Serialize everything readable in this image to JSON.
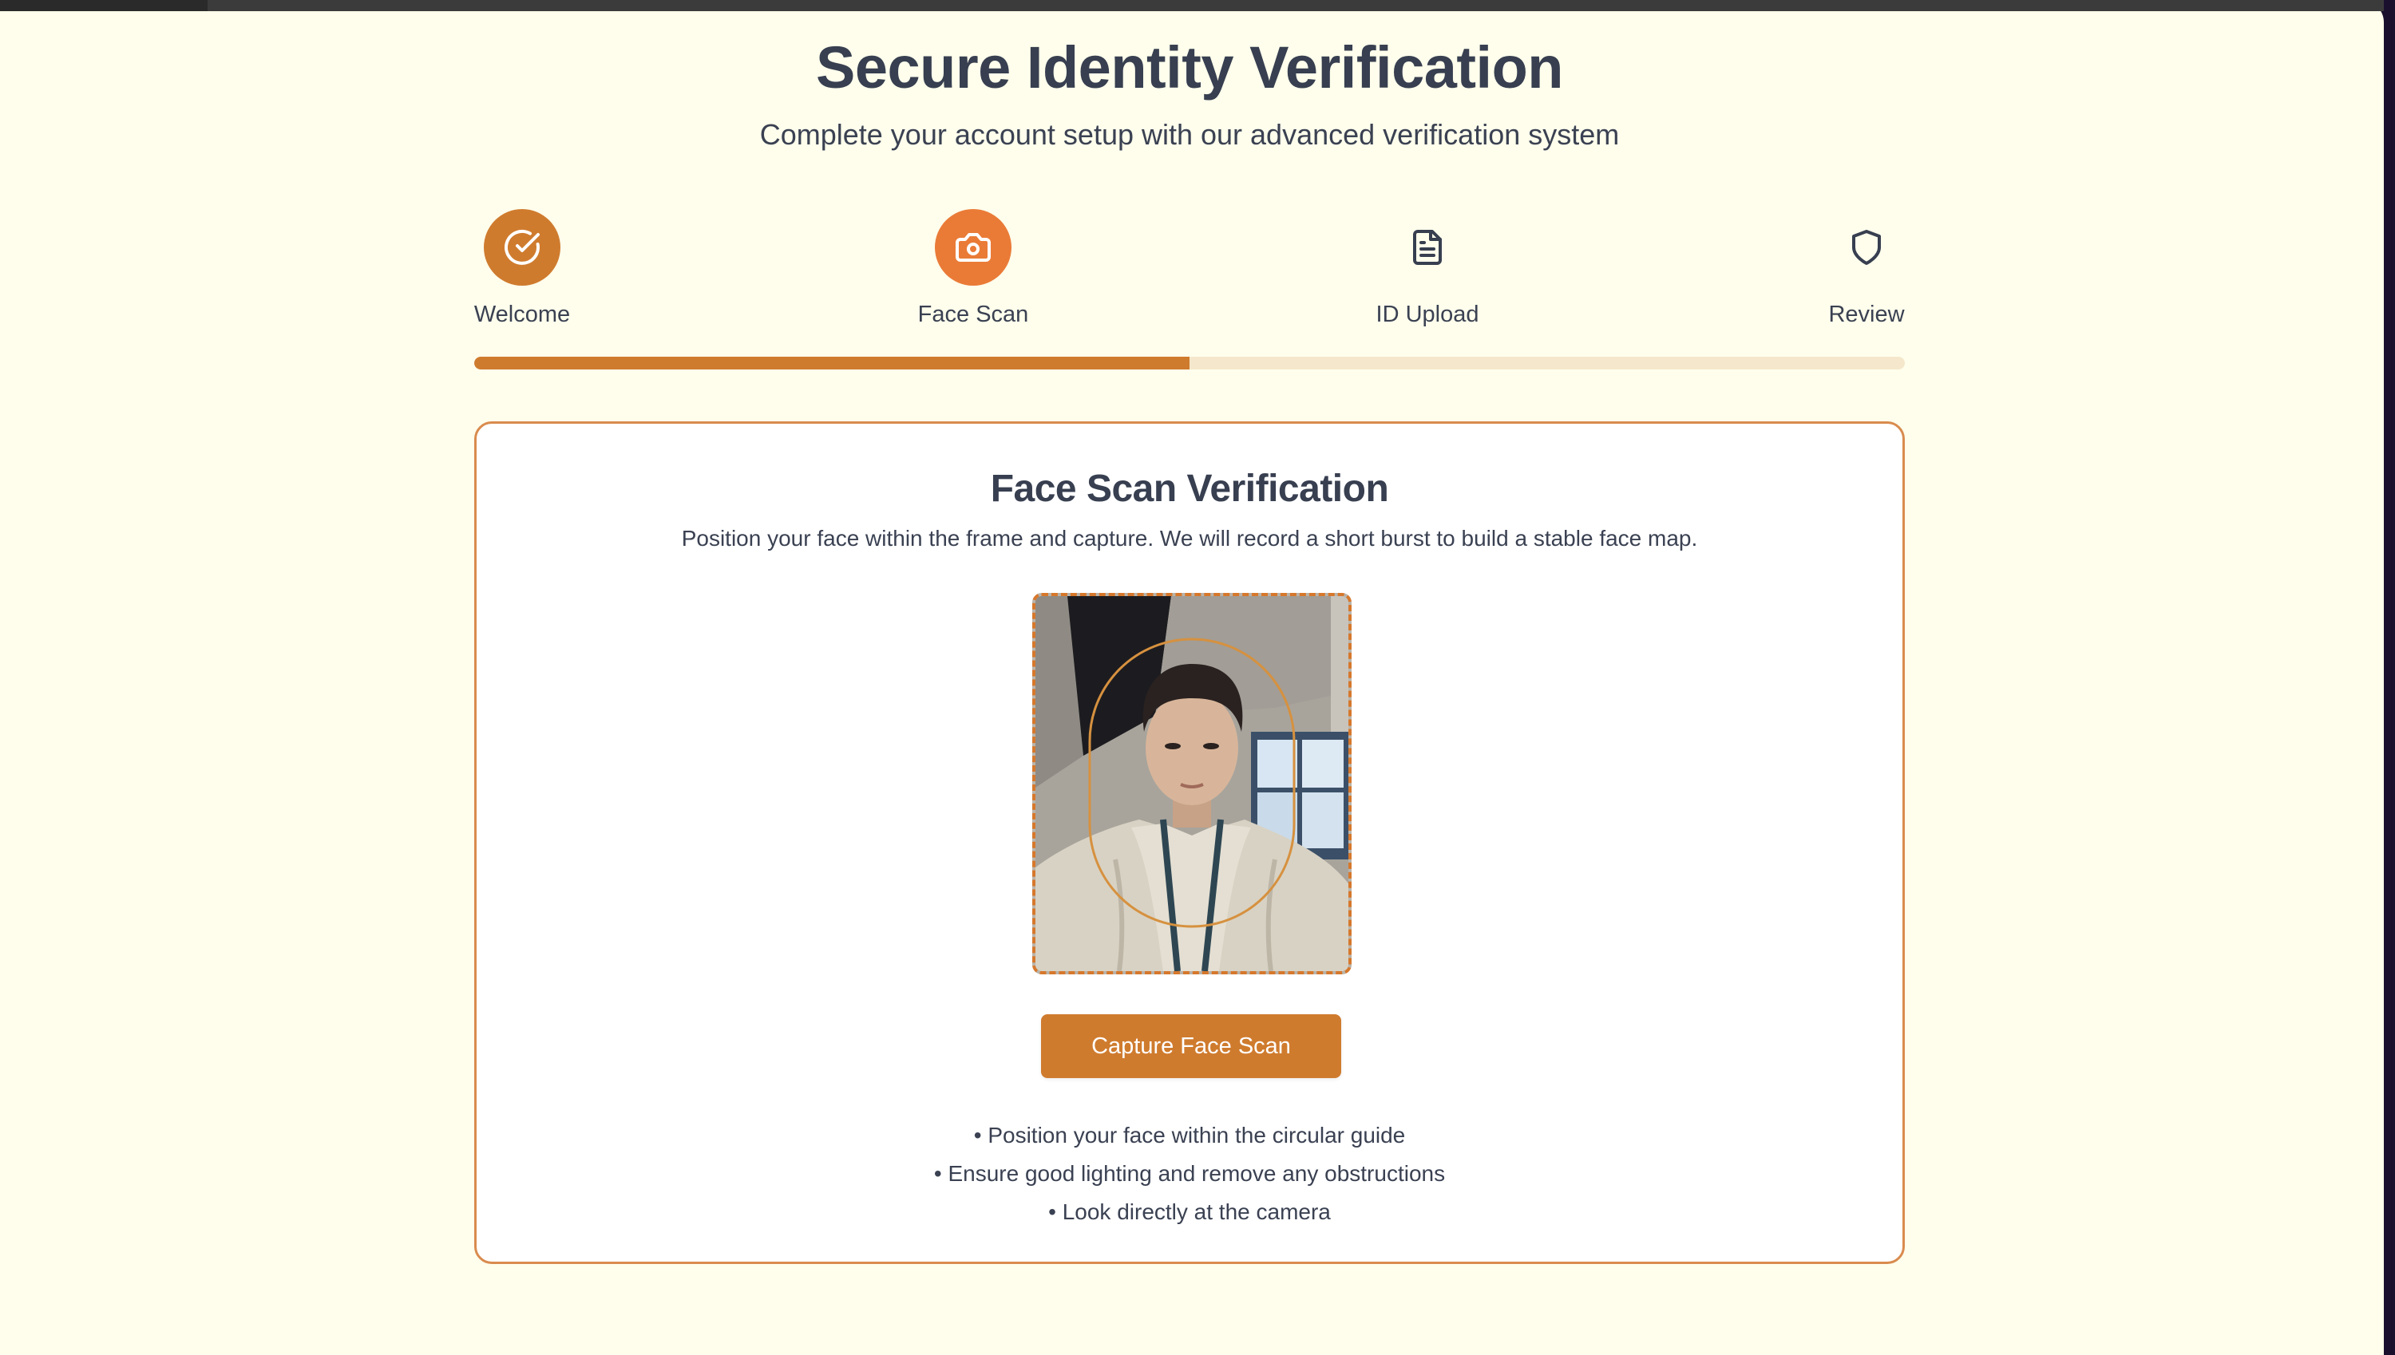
{
  "header": {
    "title": "Secure Identity Verification",
    "subtitle": "Complete your account setup with our advanced verification system"
  },
  "stepper": {
    "steps": [
      {
        "label": "Welcome",
        "icon": "check-circle-icon",
        "state": "completed"
      },
      {
        "label": "Face Scan",
        "icon": "camera-icon",
        "state": "active"
      },
      {
        "label": "ID Upload",
        "icon": "document-icon",
        "state": "pending"
      },
      {
        "label": "Review",
        "icon": "shield-icon",
        "state": "pending"
      }
    ],
    "progress_percent": 50
  },
  "card": {
    "title": "Face Scan Verification",
    "description": "Position your face within the frame and capture. We will record a short burst to build a stable face map.",
    "camera": {
      "guide_shape": "oval",
      "content": "live-camera-preview"
    },
    "capture_button_label": "Capture Face Scan",
    "tips": [
      "• Position your face within the circular guide",
      "• Ensure good lighting and remove any obstructions",
      "• Look directly at the camera"
    ]
  },
  "colors": {
    "background": "#fffeec",
    "accent": "#cf7b2e",
    "accent_active": "#ea7b37",
    "track": "#f5e7cb",
    "text": "#373f50",
    "card_border": "#d98b4e"
  }
}
